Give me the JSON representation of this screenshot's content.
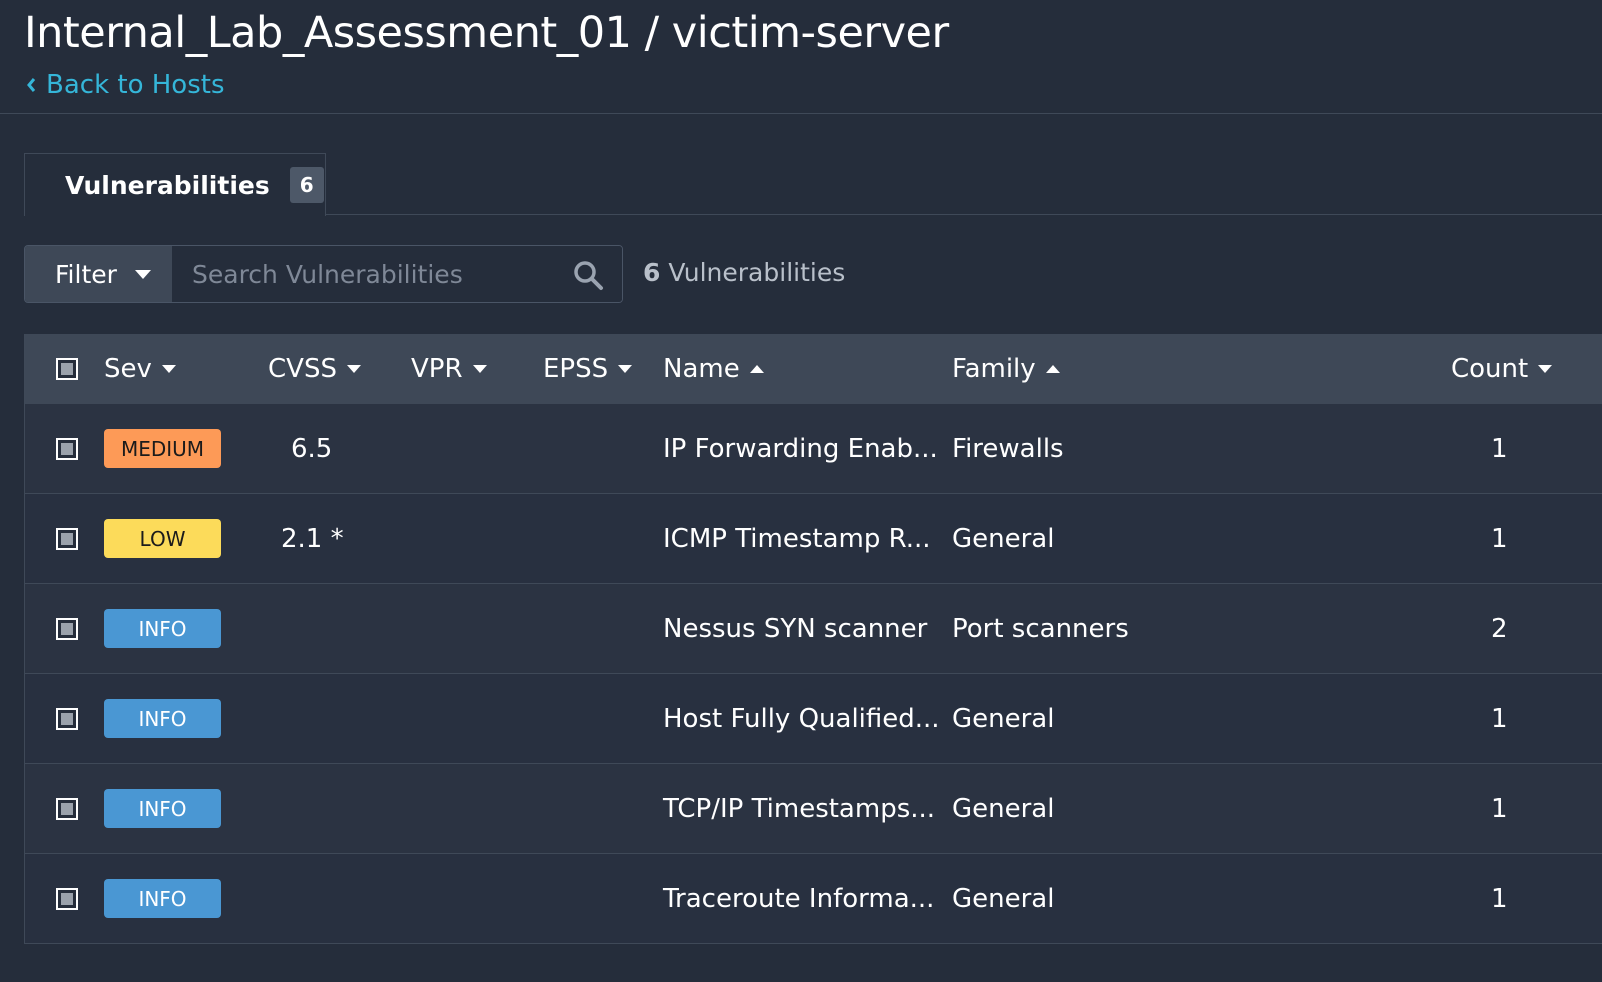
{
  "header": {
    "title": "Internal_Lab_Assessment_01 / victim-server",
    "back_label": "Back to Hosts"
  },
  "tabs": [
    {
      "label": "Vulnerabilities",
      "count": "6"
    }
  ],
  "toolbar": {
    "filter_label": "Filter",
    "search_placeholder": "Search Vulnerabilities",
    "result_count_number": "6",
    "result_count_label": "Vulnerabilities"
  },
  "table": {
    "columns": {
      "sev": "Sev",
      "cvss": "CVSS",
      "vpr": "VPR",
      "epss": "EPSS",
      "name": "Name",
      "family": "Family",
      "count": "Count"
    },
    "rows": [
      {
        "severity": "MEDIUM",
        "severity_color": "#fd9a57",
        "cvss": "6.5",
        "vpr": "",
        "epss": "",
        "name": "IP Forwarding Enab...",
        "family": "Firewalls",
        "count": "1"
      },
      {
        "severity": "LOW",
        "severity_color": "#fcdb5a",
        "cvss": "2.1 *",
        "vpr": "",
        "epss": "",
        "name": "ICMP Timestamp R...",
        "family": "General",
        "count": "1"
      },
      {
        "severity": "INFO",
        "severity_color": "#4a97d3",
        "cvss": "",
        "vpr": "",
        "epss": "",
        "name": "Nessus SYN scanner",
        "family": "Port scanners",
        "count": "2"
      },
      {
        "severity": "INFO",
        "severity_color": "#4a97d3",
        "cvss": "",
        "vpr": "",
        "epss": "",
        "name": "Host Fully Qualified...",
        "family": "General",
        "count": "1"
      },
      {
        "severity": "INFO",
        "severity_color": "#4a97d3",
        "cvss": "",
        "vpr": "",
        "epss": "",
        "name": "TCP/IP Timestamps...",
        "family": "General",
        "count": "1"
      },
      {
        "severity": "INFO",
        "severity_color": "#4a97d3",
        "cvss": "",
        "vpr": "",
        "epss": "",
        "name": "Traceroute Informa...",
        "family": "General",
        "count": "1"
      }
    ]
  }
}
